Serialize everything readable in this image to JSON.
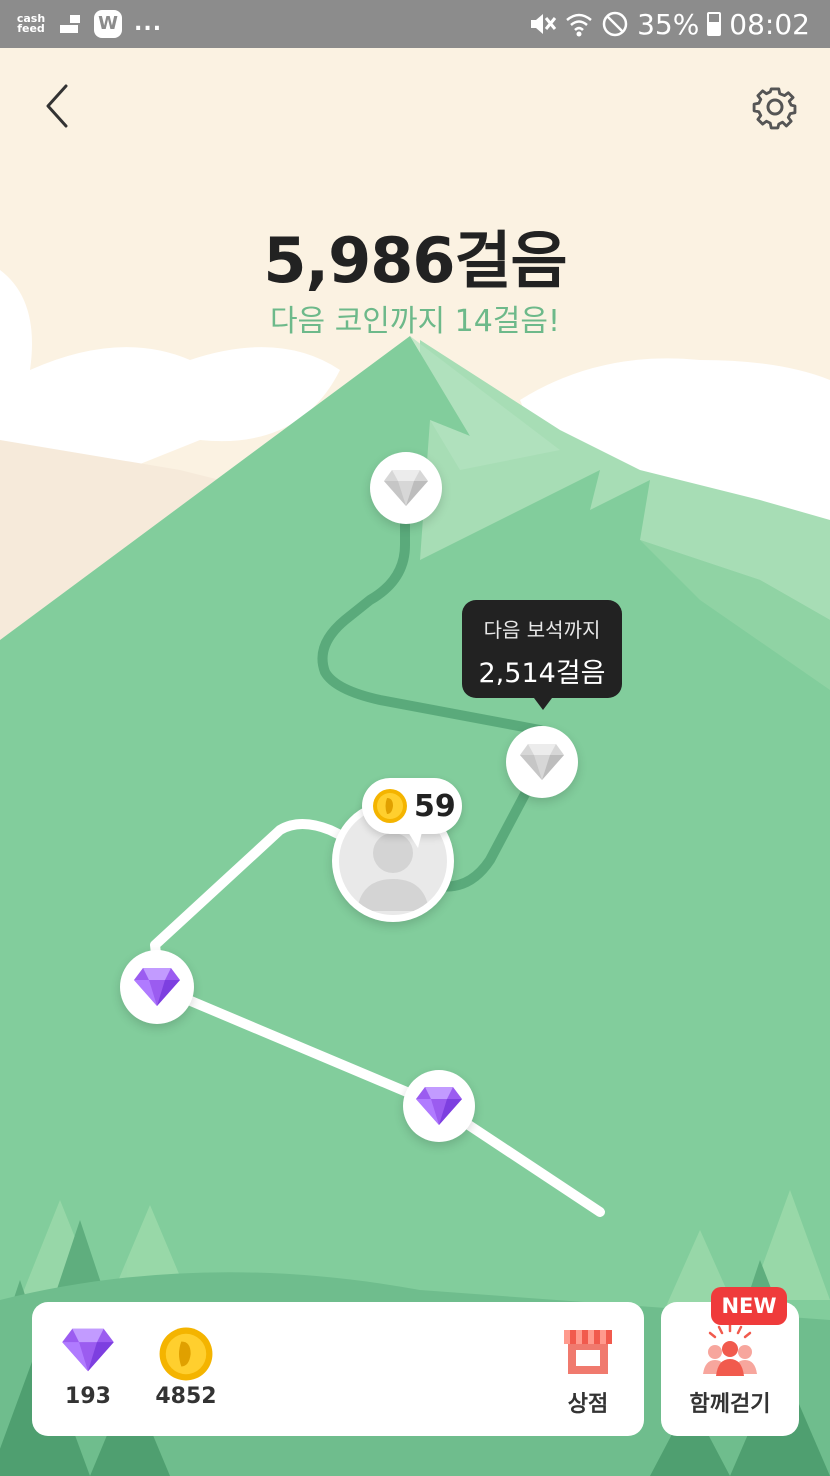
{
  "status_bar": {
    "app_logo_text": "cash feed",
    "w_app_text": "W",
    "more_text": "...",
    "battery": "35%",
    "time": "08:02"
  },
  "header": {
    "steps_label": "5,986걸음",
    "next_coin_label": "다음 코인까지 14걸음!"
  },
  "map": {
    "tooltip_label": "다음 보석까지",
    "tooltip_value": "2,514걸음",
    "pending_coins": "59"
  },
  "wallet": {
    "gem_count": "193",
    "coin_count": "4852",
    "shop_label": "상점"
  },
  "walk_together": {
    "label": "함께걷기",
    "badge": "NEW"
  },
  "colors": {
    "sky": "#fbf2e2",
    "mountain": "#82cd9c",
    "accent_green": "#6db98a",
    "badge_red": "#ef3b3b",
    "gem_purple": "#9b5cf0"
  },
  "icons": [
    "back-icon",
    "gear-icon",
    "diamond-icon",
    "gem-icon",
    "coin-icon",
    "shop-icon",
    "group-walk-icon"
  ]
}
